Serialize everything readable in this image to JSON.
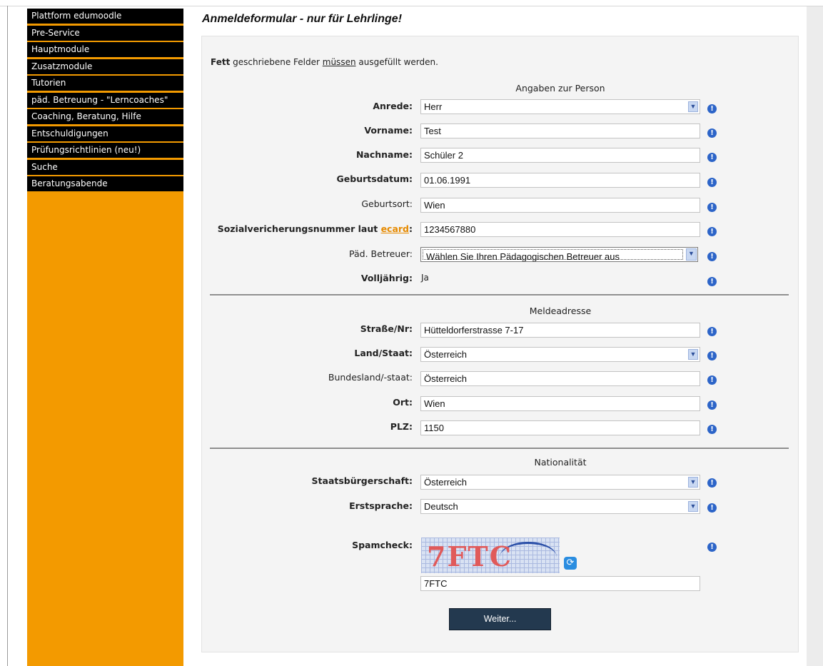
{
  "sidebar": {
    "items": [
      "Plattform edumoodle",
      "Pre-Service",
      "Hauptmodule",
      "Zusatzmodule",
      "Tutorien",
      "päd. Betreuung - \"Lerncoaches\"",
      "Coaching, Beratung, Hilfe",
      "Entschuldigungen",
      "Prüfungsrichtlinien (neu!)",
      "Suche",
      "Beratungsabende"
    ]
  },
  "page": {
    "title": "Anmeldeformular - nur für Lehrlinge!",
    "intro_bold": "Fett",
    "intro_mid": " geschriebene Felder ",
    "intro_underline": "müssen",
    "intro_end": " ausgefüllt werden."
  },
  "sections": {
    "person": "Angaben zur Person",
    "address": "Meldeadresse",
    "nationality": "Nationalität"
  },
  "fields": {
    "anrede": {
      "label": "Anrede:",
      "value": "Herr"
    },
    "vorname": {
      "label": "Vorname:",
      "value": "Test"
    },
    "nachname": {
      "label": "Nachname:",
      "value": "Schüler 2"
    },
    "geburtsdatum": {
      "label": "Geburtsdatum:",
      "value": "01.06.1991"
    },
    "geburtsort": {
      "label": "Geburtsort:",
      "value": "Wien"
    },
    "svnr": {
      "label_pre": "Sozialvericherungsnummer laut ",
      "label_link": "ecard",
      "label_post": ":",
      "value": "1234567880"
    },
    "betreuer": {
      "label": "Päd. Betreuer:",
      "value": "Wählen Sie Ihren Pädagogischen Betreuer aus"
    },
    "volljaehrig": {
      "label": "Volljährig:",
      "value": "Ja"
    },
    "strasse": {
      "label": "Straße/Nr:",
      "value": "Hütteldorferstrasse 7-17"
    },
    "land": {
      "label": "Land/Staat:",
      "value": "Österreich"
    },
    "bundesland": {
      "label": "Bundesland/-staat:",
      "value": "Österreich"
    },
    "ort": {
      "label": "Ort:",
      "value": "Wien"
    },
    "plz": {
      "label": "PLZ:",
      "value": "1150"
    },
    "staatsbuergerschaft": {
      "label": "Staatsbürgerschaft:",
      "value": "Österreich"
    },
    "erstsprache": {
      "label": "Erstsprache:",
      "value": "Deutsch"
    },
    "spamcheck": {
      "label": "Spamcheck:",
      "captcha_text": "7FTC",
      "value": "7FTC"
    }
  },
  "buttons": {
    "submit": "Weiter..."
  },
  "icons": {
    "info": "info-icon",
    "refresh": "refresh-icon",
    "dropdown": "chevron-down-icon"
  },
  "colors": {
    "sidebar": "#f39a00",
    "nav": "#000000",
    "submit": "#23394f",
    "link": "#e68a00",
    "info": "#2c64c8"
  }
}
